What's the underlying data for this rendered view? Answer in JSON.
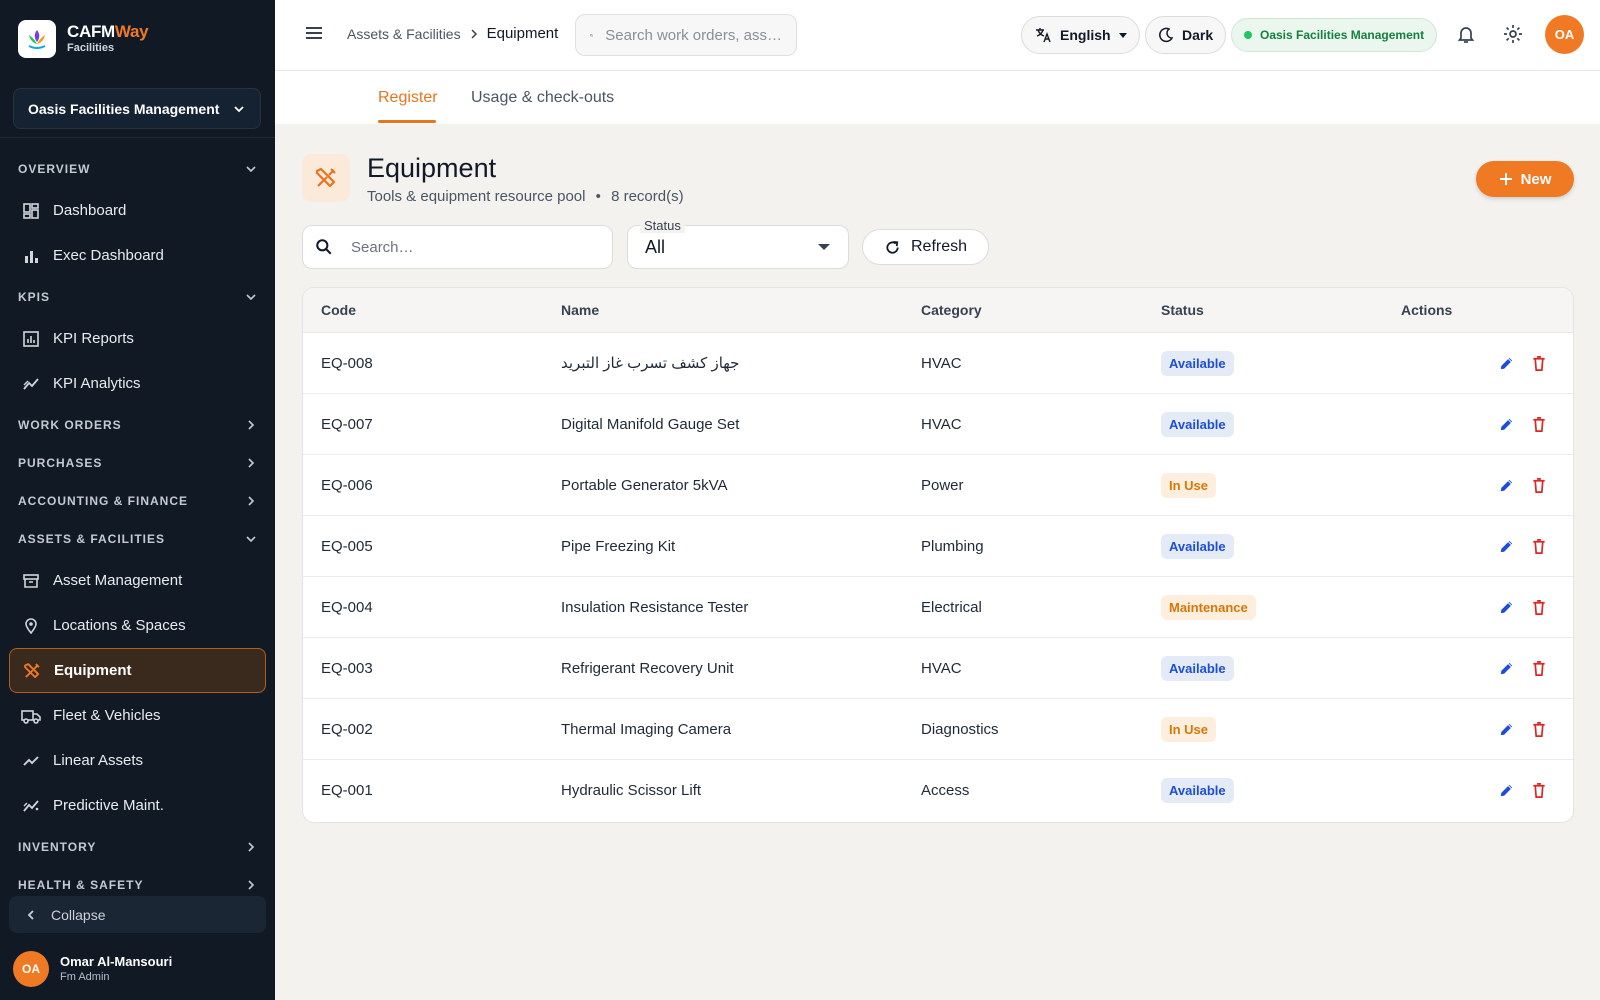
{
  "brand": {
    "name_main": "CAFM",
    "name_accent": "Way",
    "subtitle": "Facilities"
  },
  "sidebar": {
    "org": "Oasis Facilities Management",
    "sections": [
      {
        "label": "OVERVIEW",
        "expanded": true,
        "items": [
          {
            "label": "Dashboard",
            "icon": "dashboard-icon"
          },
          {
            "label": "Exec Dashboard",
            "icon": "bar-chart-icon"
          }
        ]
      },
      {
        "label": "KPIS",
        "expanded": true,
        "items": [
          {
            "label": "KPI Reports",
            "icon": "report-icon"
          },
          {
            "label": "KPI Analytics",
            "icon": "analytics-icon"
          }
        ]
      },
      {
        "label": "WORK ORDERS",
        "expanded": false,
        "items": []
      },
      {
        "label": "PURCHASES",
        "expanded": false,
        "items": []
      },
      {
        "label": "ACCOUNTING & FINANCE",
        "expanded": false,
        "items": []
      },
      {
        "label": "ASSETS & FACILITIES",
        "expanded": true,
        "items": [
          {
            "label": "Asset Management",
            "icon": "archive-icon"
          },
          {
            "label": "Locations & Spaces",
            "icon": "pin-icon"
          },
          {
            "label": "Equipment",
            "icon": "tools-icon",
            "active": true
          },
          {
            "label": "Fleet & Vehicles",
            "icon": "truck-icon"
          },
          {
            "label": "Linear Assets",
            "icon": "line-icon"
          },
          {
            "label": "Predictive Maint.",
            "icon": "predict-icon"
          }
        ]
      },
      {
        "label": "INVENTORY",
        "expanded": false,
        "items": []
      },
      {
        "label": "HEALTH & SAFETY",
        "expanded": false,
        "items": []
      }
    ],
    "collapse_label": "Collapse",
    "user": {
      "initials": "OA",
      "name": "Omar Al-Mansouri",
      "role": "Fm Admin"
    }
  },
  "topbar": {
    "breadcrumb": [
      "Assets & Facilities",
      "Equipment"
    ],
    "search_placeholder": "Search work orders, ass…",
    "language": "English",
    "theme": "Dark",
    "org": "Oasis Facilities Management",
    "avatar_initials": "OA"
  },
  "tabs": [
    "Register",
    "Usage & check-outs"
  ],
  "page": {
    "title": "Equipment",
    "subtitle": "Tools & equipment resource pool",
    "separator": "•",
    "count": "8 record(s)",
    "new_label": "New"
  },
  "filters": {
    "search_placeholder": "Search…",
    "status_label": "Status",
    "status_value": "All",
    "refresh_label": "Refresh"
  },
  "table": {
    "headers": [
      "Code",
      "Name",
      "Category",
      "Status",
      "Actions"
    ],
    "rows": [
      {
        "code": "EQ-008",
        "name": "جهاز كشف تسرب غاز التبريد",
        "category": "HVAC",
        "status": "Available",
        "status_type": "available"
      },
      {
        "code": "EQ-007",
        "name": "Digital Manifold Gauge Set",
        "category": "HVAC",
        "status": "Available",
        "status_type": "available"
      },
      {
        "code": "EQ-006",
        "name": "Portable Generator 5kVA",
        "category": "Power",
        "status": "In Use",
        "status_type": "inuse"
      },
      {
        "code": "EQ-005",
        "name": "Pipe Freezing Kit",
        "category": "Plumbing",
        "status": "Available",
        "status_type": "available"
      },
      {
        "code": "EQ-004",
        "name": "Insulation Resistance Tester",
        "category": "Electrical",
        "status": "Maintenance",
        "status_type": "maintenance"
      },
      {
        "code": "EQ-003",
        "name": "Refrigerant Recovery Unit",
        "category": "HVAC",
        "status": "Available",
        "status_type": "available"
      },
      {
        "code": "EQ-002",
        "name": "Thermal Imaging Camera",
        "category": "Diagnostics",
        "status": "In Use",
        "status_type": "inuse"
      },
      {
        "code": "EQ-001",
        "name": "Hydraulic Scissor Lift",
        "category": "Access",
        "status": "Available",
        "status_type": "available"
      }
    ]
  },
  "colors": {
    "accent": "#f07a24",
    "sidebar_bg": "#111a24",
    "available": "#1d4ed8",
    "in_use": "#d97706",
    "delete": "#dc2626",
    "edit": "#1d4ed8"
  }
}
